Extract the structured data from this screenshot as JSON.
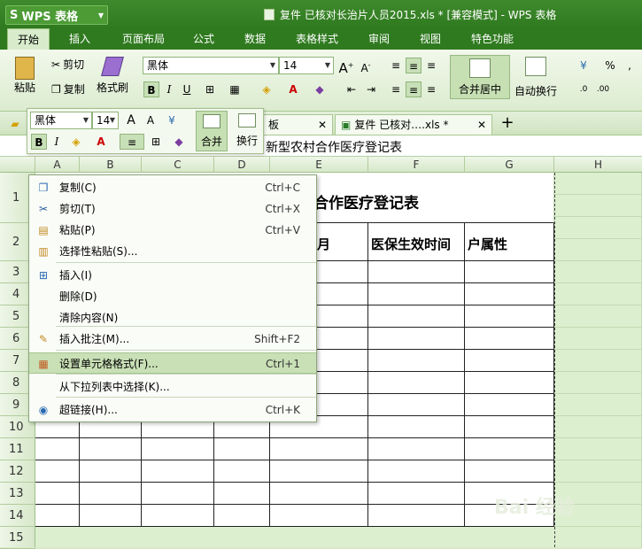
{
  "app": {
    "logo_s": "S",
    "logo_text": "WPS 表格",
    "window_title": "复件 已核对长治片人员2015.xls * [兼容模式] - WPS 表格"
  },
  "menu": {
    "tabs": [
      "开始",
      "插入",
      "页面布局",
      "公式",
      "数据",
      "表格样式",
      "审阅",
      "视图",
      "特色功能"
    ],
    "active": "开始"
  },
  "ribbon": {
    "paste": "粘贴",
    "cut": "剪切",
    "copy": "复制",
    "format_painter": "格式刷",
    "font_name": "黑体",
    "font_size": "14",
    "bold": "B",
    "italic": "I",
    "underline": "U",
    "merge_center": "合并居中",
    "wrap_text": "自动换行",
    "percent": "%",
    "comma": ","
  },
  "mini_toolbar": {
    "font_name": "黑体",
    "font_size": "14",
    "bold": "B",
    "italic": "I",
    "merge": "合并",
    "wrap": "换行"
  },
  "doc_tabs": [
    {
      "label": "板"
    },
    {
      "label": "复件 已核对….xls *"
    }
  ],
  "formula_bar": {
    "value": "新型农村合作医疗登记表"
  },
  "columns": [
    "A",
    "B",
    "C",
    "D",
    "E",
    "F",
    "G",
    "H"
  ],
  "rows": [
    "1",
    "2",
    "3",
    "4",
    "5",
    "6",
    "7",
    "8",
    "9",
    "10",
    "11",
    "12",
    "13",
    "14",
    "15"
  ],
  "sheet": {
    "title_fragment": "合作医疗登记表",
    "e2": "月",
    "f2": "医保生效时间",
    "g2": "户属性"
  },
  "context_menu": {
    "items": [
      {
        "label": "复制(C)",
        "shortcut": "Ctrl+C",
        "icon": "copy-icon"
      },
      {
        "label": "剪切(T)",
        "shortcut": "Ctrl+X",
        "icon": "scissors-icon"
      },
      {
        "label": "粘贴(P)",
        "shortcut": "Ctrl+V",
        "icon": "paste-icon"
      },
      {
        "label": "选择性粘贴(S)...",
        "shortcut": "",
        "icon": "paste-special-icon"
      },
      {
        "label": "插入(I)",
        "shortcut": "",
        "icon": "insert-icon"
      },
      {
        "label": "删除(D)",
        "shortcut": "",
        "icon": ""
      },
      {
        "label": "清除内容(N)",
        "shortcut": "",
        "icon": ""
      },
      {
        "label": "插入批注(M)...",
        "shortcut": "Shift+F2",
        "icon": "comment-icon"
      },
      {
        "label": "设置单元格格式(F)...",
        "shortcut": "Ctrl+1",
        "icon": "format-cells-icon"
      },
      {
        "label": "从下拉列表中选择(K)...",
        "shortcut": "",
        "icon": ""
      },
      {
        "label": "超链接(H)...",
        "shortcut": "Ctrl+K",
        "icon": "globe-link-icon"
      }
    ],
    "highlighted_index": 8
  },
  "watermark": "Bai 经验",
  "colors": {
    "title_bar": "#2f7a1f",
    "sheet_bg": "#dcefcf",
    "highlight": "#c9e0b6"
  }
}
